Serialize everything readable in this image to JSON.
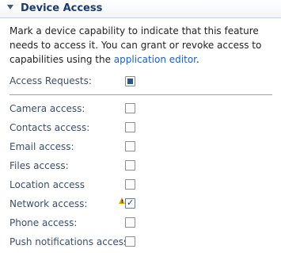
{
  "section": {
    "title": "Device Access"
  },
  "description": {
    "text_before": "Mark a device capability to indicate that this feature needs to access it. You can grant or revoke access to capabilities using the ",
    "link": "application editor",
    "text_after": "."
  },
  "access_requests": {
    "label": "Access Requests:",
    "state": "partial"
  },
  "capabilities": [
    {
      "label": "Camera access:",
      "checked": false
    },
    {
      "label": "Contacts access:",
      "checked": false
    },
    {
      "label": "Email access:",
      "checked": false
    },
    {
      "label": "Files access:",
      "checked": false
    },
    {
      "label": "Location access",
      "checked": false
    },
    {
      "label": "Network access:",
      "checked": true,
      "warning": true
    },
    {
      "label": "Phone access:",
      "checked": false
    },
    {
      "label": "Push notifications access:",
      "checked": false
    }
  ],
  "colors": {
    "header_title": "#1b3a73",
    "link": "#1f5fbf",
    "label": "#3b4d6b",
    "warning": "#e0a800"
  }
}
